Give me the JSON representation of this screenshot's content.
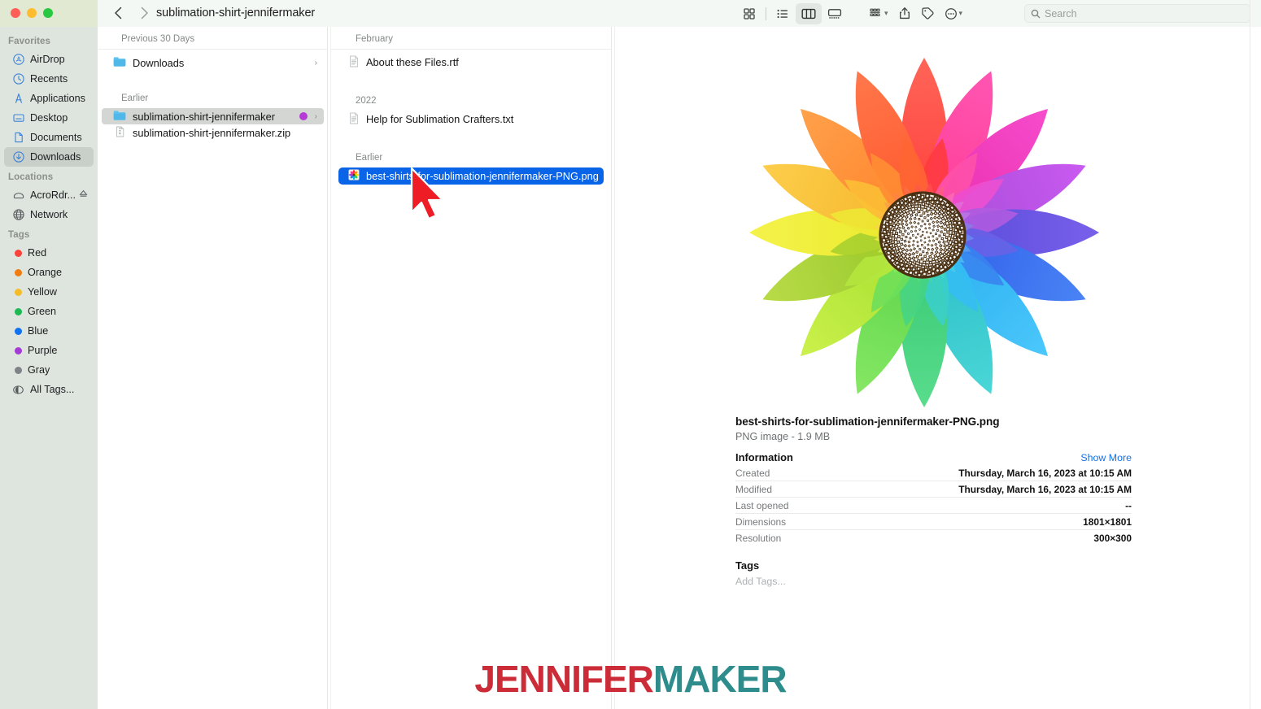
{
  "window": {
    "title": "sublimation-shirt-jennifermaker",
    "traffic_lights": [
      "close-red",
      "minimize-yellow",
      "maximize-green"
    ],
    "nav_back": "back-chevron",
    "nav_forward": "forward-chevron"
  },
  "toolbar": {
    "view_icons": [
      {
        "name": "icon-view-button",
        "label": "Icon View"
      },
      {
        "name": "list-view-button",
        "label": "List View"
      },
      {
        "name": "column-view-button",
        "label": "Column View",
        "active": true
      },
      {
        "name": "gallery-view-button",
        "label": "Gallery View"
      }
    ],
    "group_button": "group-by-button",
    "share_button": "share-button",
    "tag_button": "tag-button",
    "more_button": "more-actions-button"
  },
  "search": {
    "placeholder": "Search",
    "value": "",
    "icon": "search-icon"
  },
  "sidebar": {
    "sections": [
      {
        "title": "Favorites",
        "items": [
          {
            "label": "AirDrop",
            "icon": "airdrop-icon",
            "selected": false
          },
          {
            "label": "Recents",
            "icon": "clock-icon",
            "selected": false
          },
          {
            "label": "Applications",
            "icon": "applications-icon",
            "selected": false
          },
          {
            "label": "Desktop",
            "icon": "desktop-icon",
            "selected": false
          },
          {
            "label": "Documents",
            "icon": "document-icon",
            "selected": false
          },
          {
            "label": "Downloads",
            "icon": "downloads-icon",
            "selected": true
          }
        ]
      },
      {
        "title": "Locations",
        "items": [
          {
            "label": "AcroRdr...",
            "icon": "disk-icon",
            "eject": true,
            "selected": false
          },
          {
            "label": "Network",
            "icon": "globe-icon",
            "selected": false
          }
        ]
      },
      {
        "title": "Tags",
        "items": [
          {
            "label": "Red",
            "icon": "tag-dot",
            "color": "#f9423a"
          },
          {
            "label": "Orange",
            "icon": "tag-dot",
            "color": "#f07c12"
          },
          {
            "label": "Yellow",
            "icon": "tag-dot",
            "color": "#f5bc28"
          },
          {
            "label": "Green",
            "icon": "tag-dot",
            "color": "#1db954"
          },
          {
            "label": "Blue",
            "icon": "tag-dot",
            "color": "#1172f0"
          },
          {
            "label": "Purple",
            "icon": "tag-dot",
            "color": "#a53bd6"
          },
          {
            "label": "Gray",
            "icon": "tag-dot",
            "color": "#7f8387"
          },
          {
            "label": "All Tags...",
            "icon": "all-tags-icon",
            "color": ""
          }
        ]
      }
    ]
  },
  "column1": {
    "groups": [
      {
        "header": "Previous 30 Days",
        "rows": [
          {
            "name": "Downloads",
            "icon": "folder-icon",
            "selected": false,
            "chevron": true,
            "tag": ""
          }
        ]
      },
      {
        "header": "Earlier",
        "rows": [
          {
            "name": "sublimation-shirt-jennifermaker",
            "icon": "folder-icon",
            "selected": true,
            "chevron": true,
            "tag": "#b53ad6"
          },
          {
            "name": "sublimation-shirt-jennifermaker.zip",
            "icon": "archive-icon",
            "selected": false,
            "chevron": false,
            "tag": ""
          }
        ]
      }
    ]
  },
  "column2": {
    "groups": [
      {
        "header": "February",
        "rows": [
          {
            "name": "About these Files.rtf",
            "icon": "rtf-file-icon",
            "selected": false
          }
        ]
      },
      {
        "header": "2022",
        "rows": [
          {
            "name": "Help for Sublimation Crafters.txt",
            "icon": "txt-file-icon",
            "selected": false
          }
        ]
      },
      {
        "header": "Earlier",
        "rows": [
          {
            "name": "best-shirts-for-sublimation-jennifermaker-PNG.png",
            "icon": "png-file-icon",
            "selected": true
          }
        ]
      }
    ]
  },
  "preview": {
    "image_alt": "rainbow-flower-sublimation-design",
    "file_name": "best-shirts-for-sublimation-jennifermaker-PNG.png",
    "file_kind_size": "PNG image - 1.9 MB",
    "information_title": "Information",
    "show_more_label": "Show More",
    "info_rows": [
      {
        "key": "Created",
        "value": "Thursday, March 16, 2023 at 10:15 AM"
      },
      {
        "key": "Modified",
        "value": "Thursday, March 16, 2023 at 10:15 AM"
      },
      {
        "key": "Last opened",
        "value": "--"
      },
      {
        "key": "Dimensions",
        "value": "1801×1801"
      },
      {
        "key": "Resolution",
        "value": "300×300"
      }
    ],
    "tags_title": "Tags",
    "tags_add_placeholder": "Add Tags..."
  },
  "watermark": {
    "part1": "JENNIFER",
    "part2": "MAKER",
    "color1": "#cb2c37",
    "color2": "#2e8c8c"
  },
  "cursor": {
    "name": "red-arrow-pointer",
    "color": "#ee1c25"
  }
}
